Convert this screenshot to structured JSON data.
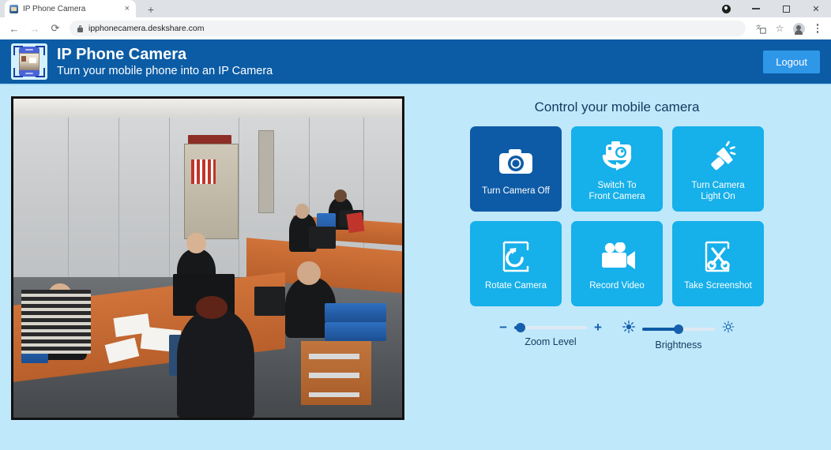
{
  "browser": {
    "tab_title": "IP Phone Camera",
    "tab_close_label": "×",
    "new_tab_label": "+",
    "back_label": "←",
    "forward_label": "→",
    "reload_label": "⟳",
    "url": "ipphonecamera.deskshare.com",
    "translate_icon_label": "",
    "bookmark_label": "☆",
    "minimize_label": "−",
    "maximize_label": "",
    "close_label": "✕"
  },
  "header": {
    "title": "IP Phone Camera",
    "subtitle": "Turn your mobile phone into an IP Camera",
    "logout_label": "Logout",
    "bg_color": "#0b5ca5",
    "logout_color": "#2f97e8"
  },
  "page": {
    "bg_color": "#c0e8fb"
  },
  "controls": {
    "title": "Control your mobile camera",
    "buttons": [
      {
        "label_line1": "Turn Camera Off",
        "label_line2": "",
        "icon": "camera-icon",
        "active": true
      },
      {
        "label_line1": "Switch To",
        "label_line2": "Front Camera",
        "icon": "switch-camera-icon",
        "active": false
      },
      {
        "label_line1": "Turn Camera",
        "label_line2": "Light On",
        "icon": "flashlight-icon",
        "active": false
      },
      {
        "label_line1": "Rotate Camera",
        "label_line2": "",
        "icon": "rotate-icon",
        "active": false
      },
      {
        "label_line1": "Record Video",
        "label_line2": "",
        "icon": "camcorder-icon",
        "active": false
      },
      {
        "label_line1": "Take Screenshot",
        "label_line2": "",
        "icon": "scissors-icon",
        "active": false
      }
    ],
    "active_color": "#0d5ba6",
    "inactive_color": "#16b0ea"
  },
  "sliders": [
    {
      "name": "zoom",
      "label": "Zoom Level",
      "minus_label": "−",
      "plus_label": "+",
      "value_percent": 8
    },
    {
      "name": "brightness",
      "label": "Brightness",
      "low_icon": "brightness-low-icon",
      "high_icon": "brightness-high-icon",
      "value_percent": 50
    }
  ],
  "video": {
    "name": "camera-live-feed",
    "description": "Office room with desks, monitors and people working"
  }
}
